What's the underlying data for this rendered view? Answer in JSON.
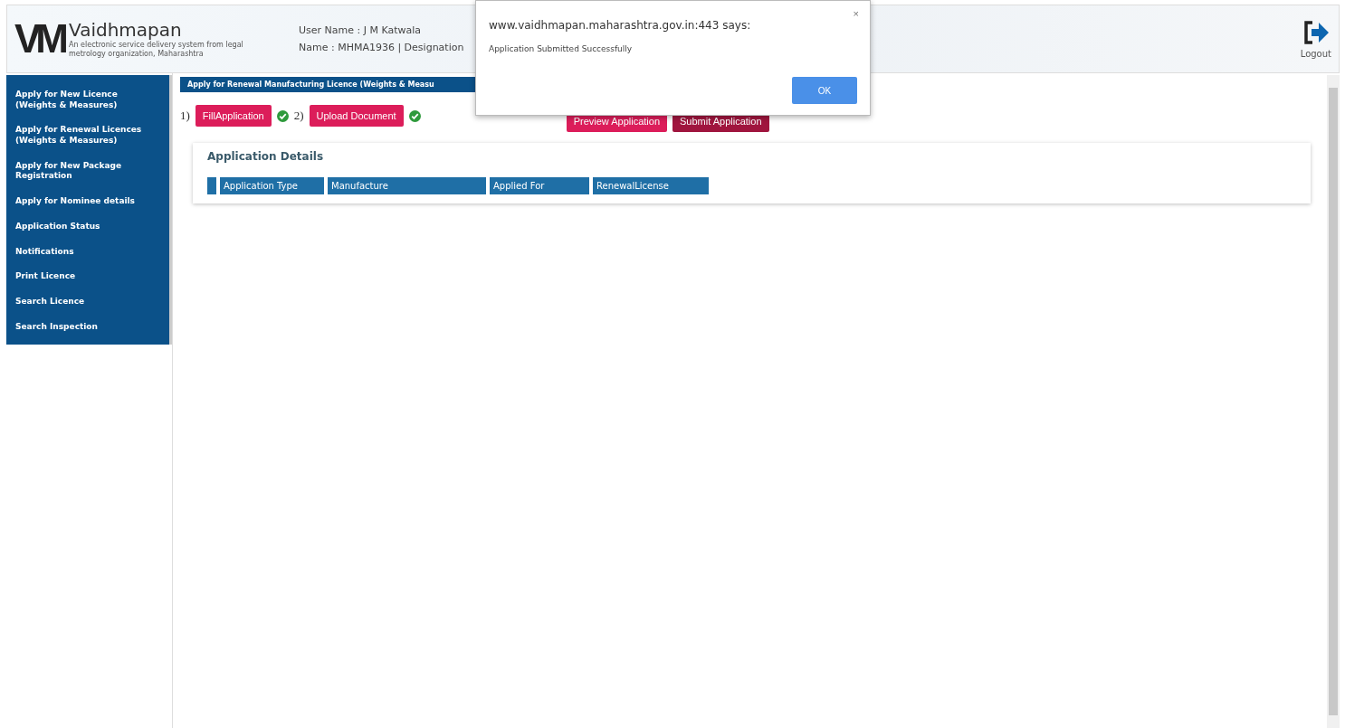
{
  "header": {
    "logo_mark": "VM",
    "brand": "Vaidhmapan",
    "tagline": "An electronic service delivery system from legal metrology organization, Maharashtra",
    "user_line": "User Name :  J M Katwala",
    "name_line": "Name : MHMA1936 | Designation",
    "logout": "Logout"
  },
  "sidebar": {
    "items": [
      {
        "label": "Apply for New Licence (Weights & Measures)",
        "selected": false
      },
      {
        "label": "Apply for Renewal Licences (Weights & Measures)",
        "selected": false
      },
      {
        "label": "Apply for New Package Registration",
        "selected": false
      },
      {
        "label": "Apply for Nominee details",
        "selected": false
      },
      {
        "label": "Application Status",
        "selected": false
      },
      {
        "label": "Notifications",
        "selected": false
      },
      {
        "label": "Print Licence",
        "selected": false
      },
      {
        "label": "Search Licence",
        "selected": false
      },
      {
        "label": "Search Inspection",
        "selected": false
      }
    ]
  },
  "page_title": "Apply for Renewal Manufacturing Licence (Weights & Measu",
  "steps": [
    {
      "number": "1)",
      "label": "FillApplication",
      "done": true
    },
    {
      "number": "2)",
      "label": "Upload Document",
      "done": true
    }
  ],
  "actions": [
    {
      "label": "Preview Application",
      "kind": "primary"
    },
    {
      "label": "Submit Application",
      "kind": "dark"
    }
  ],
  "details": {
    "title": "Application Details",
    "columns": [
      "Application Type",
      "Manufacture",
      "Applied For",
      "RenewalLicense"
    ]
  },
  "dialog": {
    "title": "www.vaidhmapan.maharashtra.gov.in:443 says:",
    "message": "Application Submitted Successfully",
    "close": "×",
    "ok": "OK"
  }
}
